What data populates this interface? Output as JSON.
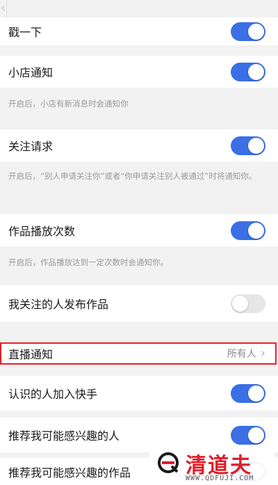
{
  "settings": [
    {
      "label": "戳一下",
      "toggle": "on"
    },
    {
      "label": "小店通知",
      "toggle": "on",
      "desc": "开启后，小店有新消息时会通知你"
    },
    {
      "label": "关注请求",
      "toggle": "on",
      "desc": "开启后，“别人申请关注你”或者“你申请关注别人被通过”时将通知你。"
    },
    {
      "label": "作品播放次数",
      "toggle": "on",
      "desc": "开启后，作品播放达到一定次数时会通知你。"
    },
    {
      "label": "我关注的人发布作品",
      "toggle": "off"
    },
    {
      "label": "直播通知",
      "value": "所有人",
      "chevron": "chevron-right-icon"
    },
    {
      "label": "认识的人加入快手",
      "toggle": "on"
    },
    {
      "label": "推荐我可能感兴趣的人",
      "toggle": "on"
    },
    {
      "label": "推荐我可能感兴趣的作品",
      "toggle": "on"
    }
  ],
  "colors": {
    "toggle_on": "#3a6fe6",
    "toggle_off": "#e6e6e6",
    "highlight": "#e0202a",
    "watermark": "#e01c2a"
  },
  "watermark": {
    "title": "清道夫",
    "url": "WWW.QDFUJI.COM"
  }
}
